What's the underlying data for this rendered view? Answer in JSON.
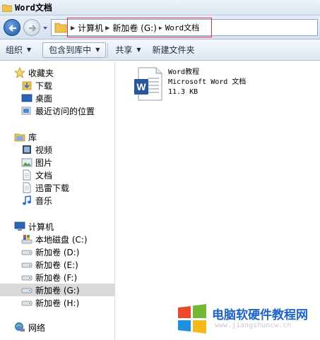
{
  "window": {
    "title": "Word文档"
  },
  "address": {
    "breadcrumbs": [
      {
        "label": "计算机"
      },
      {
        "label": "新加卷 (G:)"
      },
      {
        "label": "Word文档"
      }
    ]
  },
  "toolbar": {
    "organize": "组织",
    "include_library": "包含到库中",
    "share": "共享",
    "new_folder": "新建文件夹"
  },
  "nav": {
    "favorites": {
      "label": "收藏夹",
      "items": [
        "下载",
        "桌面",
        "最近访问的位置"
      ]
    },
    "libraries": {
      "label": "库",
      "items": [
        "视频",
        "图片",
        "文档",
        "迅雷下载",
        "音乐"
      ]
    },
    "computer": {
      "label": "计算机",
      "items": [
        "本地磁盘 (C:)",
        "新加卷 (D:)",
        "新加卷 (E:)",
        "新加卷 (F:)",
        "新加卷 (G:)",
        "新加卷 (H:)"
      ],
      "selected_index": 4
    },
    "network": {
      "label": "网络"
    }
  },
  "files": [
    {
      "name": "Word教程",
      "type": "Microsoft Word 文档",
      "size": "11.3 KB"
    }
  ],
  "watermark": {
    "text": "电脑软硬件教程网",
    "url": "www.jiangshuncw.cn"
  },
  "colors": {
    "highlight_box": "#e0302c",
    "selected_row": "#d9d9d9",
    "watermark_text": "#1d63c8"
  }
}
